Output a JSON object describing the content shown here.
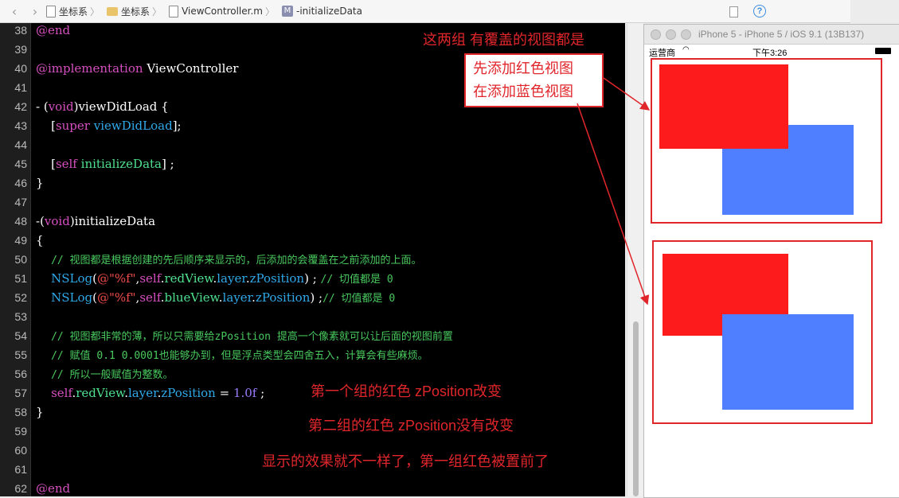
{
  "breadcrumb": [
    "坐标系",
    "坐标系",
    "ViewController.m",
    "-initializeData"
  ],
  "m_badge": "M",
  "lines": [
    {
      "n": "38",
      "html": "<span class='kw'>@end</span>"
    },
    {
      "n": "39",
      "html": ""
    },
    {
      "n": "40",
      "html": "<span class='kw'>@implementation</span> ViewController"
    },
    {
      "n": "41",
      "html": ""
    },
    {
      "n": "42",
      "html": "- (<span class='kw'>void</span>)viewDidLoad {"
    },
    {
      "n": "43",
      "html": "    [<span class='kw'>super</span> <span class='mth'>viewDidLoad</span>];"
    },
    {
      "n": "44",
      "html": ""
    },
    {
      "n": "45",
      "html": "    [<span class='kw'>self</span> <span class='grn'>initializeData</span>] ;"
    },
    {
      "n": "46",
      "html": "}"
    },
    {
      "n": "47",
      "html": ""
    },
    {
      "n": "48",
      "html": "-(<span class='kw'>void</span>)initializeData"
    },
    {
      "n": "49",
      "html": "{"
    },
    {
      "n": "50",
      "html": "    <span class='cm'>// 视图都是根据创建的先后顺序来显示的，后添加的会覆盖在之前添加的上面。</span>"
    },
    {
      "n": "51",
      "html": "    <span class='mth'>NSLog</span>(<span class='str'>@\"%f\"</span>,<span class='kw'>self</span>.<span class='grn'>redView</span>.<span class='mth'>layer</span>.<span class='mth'>zPosition</span>) ; <span class='cm'>// 切值都是 0</span>"
    },
    {
      "n": "52",
      "html": "    <span class='mth'>NSLog</span>(<span class='str'>@\"%f\"</span>,<span class='kw'>self</span>.<span class='grn'>blueView</span>.<span class='mth'>layer</span>.<span class='mth'>zPosition</span>) ;<span class='cm'>// 切值都是 0</span>"
    },
    {
      "n": "53",
      "html": ""
    },
    {
      "n": "54",
      "html": "    <span class='cm'>// 视图都非常的薄，所以只需要给zPosition 提高一个像素就可以让后面的视图前置</span>"
    },
    {
      "n": "55",
      "html": "    <span class='cm'>// 赋值 0.1 0.0001也能够办到，但是浮点类型会四舍五入，计算会有些麻烦。</span>"
    },
    {
      "n": "56",
      "html": "    <span class='cm'>// 所以一般赋值为整数。</span>"
    },
    {
      "n": "57",
      "html": "    <span class='kw'>self</span>.<span class='grn'>redView</span>.<span class='mth'>layer</span>.<span class='mth'>zPosition</span> = <span class='num'>1.0f</span> ;"
    },
    {
      "n": "58",
      "html": "}"
    },
    {
      "n": "59",
      "html": ""
    },
    {
      "n": "60",
      "html": ""
    },
    {
      "n": "61",
      "html": ""
    },
    {
      "n": "62",
      "html": "<span class='kw'>@end</span>"
    }
  ],
  "simulator": {
    "title": "iPhone 5 - iPhone 5 / iOS 9.1 (13B137)",
    "carrier": "运营商",
    "time": "下午3:26"
  },
  "annotations": {
    "top": "这两组 有覆盖的视图都是",
    "box_line1": "先添加红色视图",
    "box_line2": "在添加蓝色视图",
    "group1": "第一个组的红色 zPosition改变",
    "group2": "第二组的红色 zPosition没有改变",
    "result": "显示的效果就不一样了，第一组红色被置前了"
  },
  "colors": {
    "red": "#fe1b1b",
    "blue": "#4f7fff",
    "annotation": "#e0262b"
  }
}
